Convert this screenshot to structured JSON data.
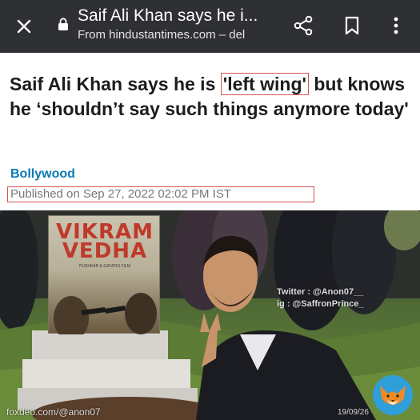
{
  "browser": {
    "page_title": "Saif Ali Khan says he i...",
    "url_text": "From hindustantimes.com – del",
    "icons": [
      "close-icon",
      "lock-icon",
      "share-icon",
      "bookmark-icon",
      "more-vert-icon"
    ]
  },
  "article": {
    "headline_before": "Saif Ali Khan says he is ",
    "headline_highlight": "'left wing'",
    "headline_after": " but knows he ‘shouldn’t say such things anymore today'",
    "category": "Bollywood",
    "published": "Published on Sep 27, 2022 02:02 PM IST"
  },
  "meme": {
    "poster_title": "VIKRAM\nVEDHA",
    "poster_credit": "PUSHKAR & GAYATRI FILM",
    "watermark_twitter": "Twitter : @Anon07__",
    "watermark_ig": "ig : @SaffronPrince_",
    "source_credit": "foxdeo.com/@anon07",
    "date_stamp": "19/09/26"
  },
  "colors": {
    "topbar_bg": "#2f3033",
    "highlight_border": "#d9534f",
    "category_blue": "#0a7bb5"
  }
}
